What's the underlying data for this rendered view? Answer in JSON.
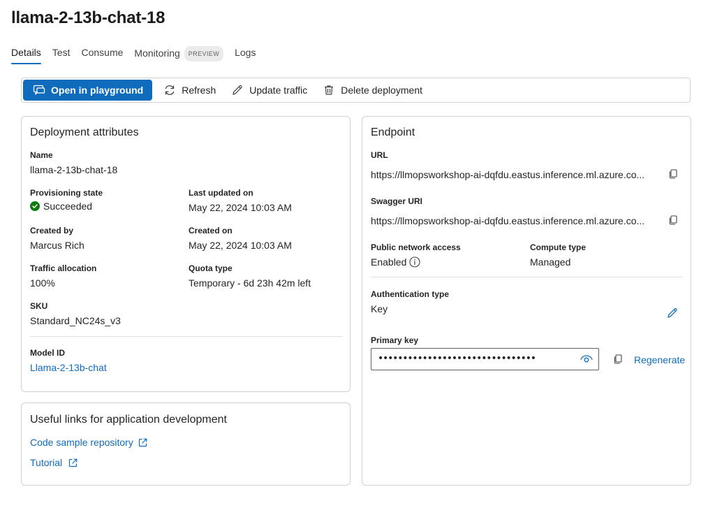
{
  "page": {
    "title": "llama-2-13b-chat-18"
  },
  "tabs": [
    {
      "label": "Details",
      "active": true
    },
    {
      "label": "Test"
    },
    {
      "label": "Consume"
    },
    {
      "label": "Monitoring",
      "badge": "PREVIEW"
    },
    {
      "label": "Logs"
    }
  ],
  "toolbar": {
    "open_playground": "Open in playground",
    "refresh": "Refresh",
    "update_traffic": "Update traffic",
    "delete_deployment": "Delete deployment"
  },
  "deployment": {
    "title": "Deployment attributes",
    "name_label": "Name",
    "name": "llama-2-13b-chat-18",
    "provisioning_label": "Provisioning state",
    "provisioning": "Succeeded",
    "last_updated_label": "Last updated on",
    "last_updated": "May 22, 2024 10:03 AM",
    "created_by_label": "Created by",
    "created_by": "Marcus Rich",
    "created_on_label": "Created on",
    "created_on": "May 22, 2024 10:03 AM",
    "traffic_label": "Traffic allocation",
    "traffic": "100%",
    "quota_label": "Quota type",
    "quota": "Temporary - 6d 23h 42m left",
    "sku_label": "SKU",
    "sku": "Standard_NC24s_v3",
    "model_id_label": "Model ID",
    "model_id": "Llama-2-13b-chat"
  },
  "useful_links": {
    "title": "Useful links for application development",
    "code_sample": "Code sample repository",
    "tutorial": "Tutorial"
  },
  "endpoint": {
    "title": "Endpoint",
    "url_label": "URL",
    "url": "https://llmopsworkshop-ai-dqfdu.eastus.inference.ml.azure.co...",
    "swagger_label": "Swagger URI",
    "swagger": "https://llmopsworkshop-ai-dqfdu.eastus.inference.ml.azure.co...",
    "network_label": "Public network access",
    "network": "Enabled",
    "compute_label": "Compute type",
    "compute": "Managed",
    "auth_label": "Authentication type",
    "auth": "Key",
    "primary_key_label": "Primary key",
    "primary_key_masked": "••••••••••••••••••••••••••••••••",
    "regenerate": "Regenerate"
  },
  "colors": {
    "accent": "#0f6cbd",
    "success": "#107c10",
    "border": "#d1d1d1"
  },
  "icons": [
    "playground-icon",
    "refresh-icon",
    "edit-icon",
    "delete-icon",
    "success-check-icon",
    "copy-icon",
    "info-icon",
    "pencil-icon",
    "eye-icon",
    "external-link-icon"
  ]
}
